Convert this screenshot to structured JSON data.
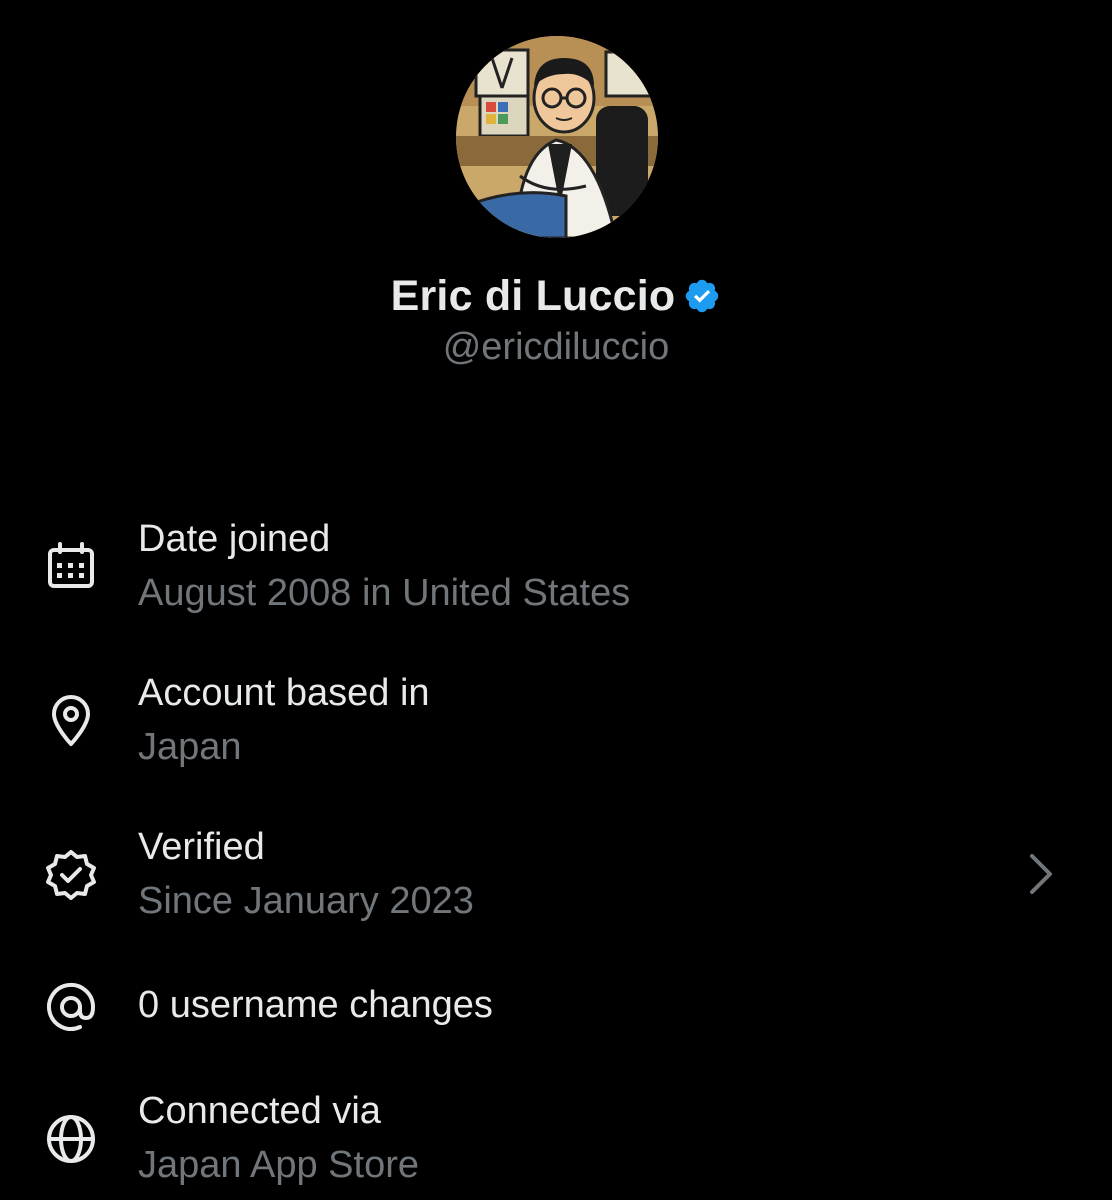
{
  "profile": {
    "display_name": "Eric di Luccio",
    "handle": "@ericdiluccio",
    "verified": true
  },
  "colors": {
    "background": "#000000",
    "primary_text": "#e7e9ea",
    "secondary_text": "#71767b",
    "verified_blue": "#1d9bf0"
  },
  "rows": [
    {
      "icon": "calendar-icon",
      "title": "Date joined",
      "subtitle": "August 2008 in United States"
    },
    {
      "icon": "location-pin-icon",
      "title": "Account based in",
      "subtitle": "Japan"
    },
    {
      "icon": "verified-badge-outline-icon",
      "title": "Verified",
      "subtitle": "Since January 2023",
      "has_chevron": true
    },
    {
      "icon": "at-sign-icon",
      "title": "0 username changes"
    },
    {
      "icon": "globe-icon",
      "title": "Connected via",
      "subtitle": "Japan App Store"
    }
  ]
}
